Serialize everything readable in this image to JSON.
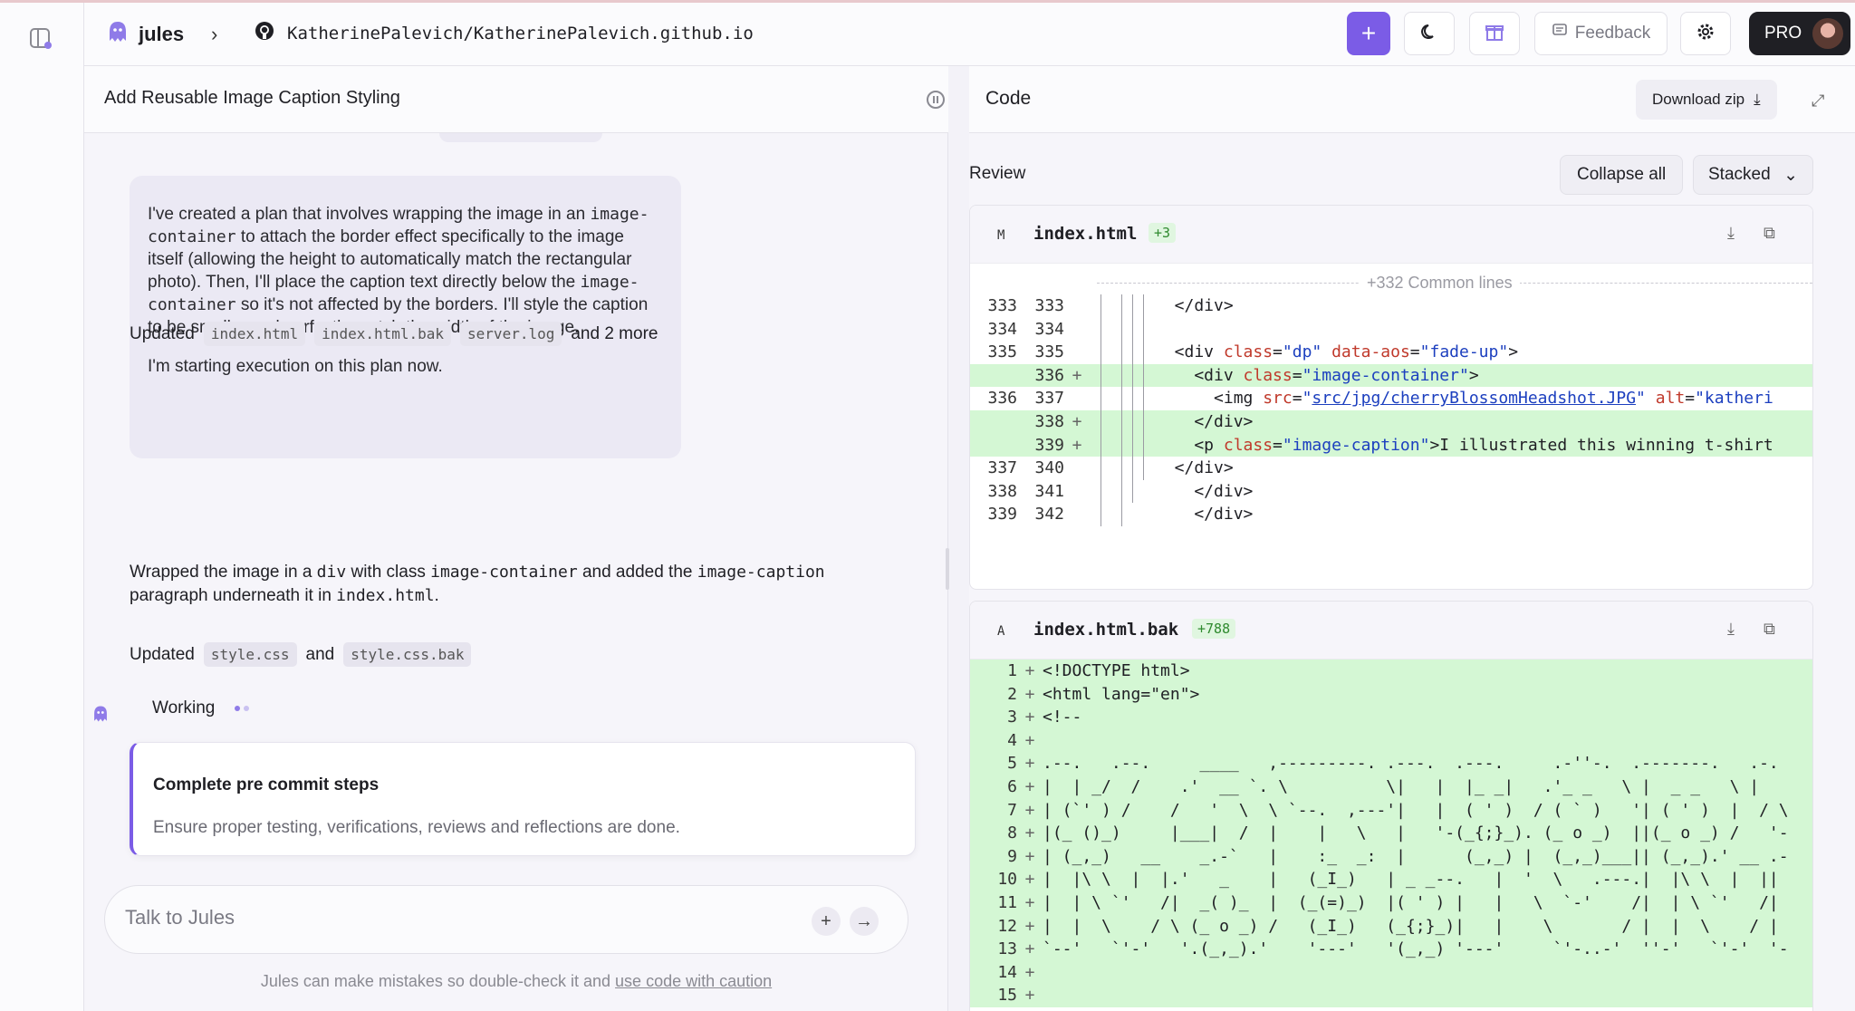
{
  "app": {
    "name": "jules",
    "repo": "KatherinePalevich/KatherinePalevich.github.io"
  },
  "topbar": {
    "feedback_label": "Feedback",
    "pro_label": "PRO"
  },
  "task": {
    "title": "Add Reusable Image Caption Styling",
    "bubble_p1_a": "I've created a plan that involves wrapping the image in an ",
    "bubble_p1_code1": "image-container",
    "bubble_p1_b": " to attach the border effect specifically to the image itself (allowing the height to automatically match the rectangular photo). Then, I'll place the caption text directly below the ",
    "bubble_p1_code2": "image-container",
    "bubble_p1_c": " so it's not affected by the borders. I'll style the caption to be smaller and perfectly match the width of the image.",
    "bubble_p2": "I'm starting execution on this plan now.",
    "updated1": {
      "label": "Updated",
      "files": [
        "index.html",
        "index.html.bak",
        "server.log"
      ],
      "more": "and 2 more"
    },
    "msg_a": "Wrapped the image in a ",
    "msg_code1": "div",
    "msg_b": " with class ",
    "msg_code2": "image-container",
    "msg_c": " and added the ",
    "msg_code3": "image-caption",
    "msg_d": " paragraph underneath it in ",
    "msg_code4": "index.html",
    "msg_e": ".",
    "updated2": {
      "label": "Updated",
      "file1": "style.css",
      "and": "and",
      "file2": "style.css.bak"
    },
    "working_label": "Working",
    "step": {
      "title": "Complete pre commit steps",
      "desc": "Ensure proper testing, verifications, reviews and reflections are done."
    },
    "composer_placeholder": "Talk to Jules",
    "disclaimer_a": "Jules can make mistakes so double-check it and ",
    "disclaimer_link": "use code with caution"
  },
  "code_panel": {
    "title": "Code",
    "download_label": "Download zip",
    "review_label": "Review",
    "collapse_label": "Collapse all",
    "view_mode": "Stacked",
    "file1": {
      "mark": "M",
      "name": "index.html",
      "badge": "+3",
      "common_lines": "+332 Common lines"
    },
    "file2": {
      "mark": "A",
      "name": "index.html.bak",
      "badge": "+788"
    }
  },
  "colors": {
    "accent": "#7b5ce6",
    "added_bg": "#d4f7d4"
  }
}
